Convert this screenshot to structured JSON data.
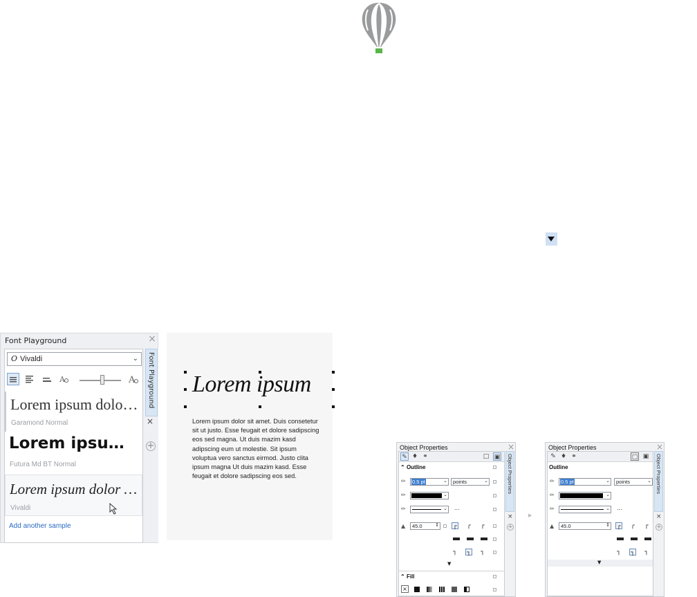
{
  "logo": {
    "icon": "balloon-logo-icon",
    "colors": {
      "body": "#9a9b9c",
      "basket": "#5bb54a"
    }
  },
  "font_playground": {
    "title": "Font Playground",
    "tab_label": "Font Playground",
    "close": "×",
    "selected_font": "Vivaldi",
    "font_icon": "O",
    "samples": [
      {
        "text": "Lorem ipsum dolor sit amet",
        "font": "Garamond Normal"
      },
      {
        "text": "Lorem ipsum dolor",
        "font": "Futura Md BT Normal"
      },
      {
        "text": "Lorem ipsum dolor sit amet",
        "font": "Vivaldi"
      }
    ],
    "add_sample": "Add another sample",
    "zoom_level": 0.55
  },
  "canvas": {
    "heading": "Lorem ipsum",
    "body": "Lorem ipsum dolor sit amet. Duis consetetur sit ut justo. Esse feugait et dolore sadipscing eos sed magna. Ut duis mazim kasd adipscing eum ut molestie. Sit ipsum voluptua vero sanctus eirmod. Justo clita ipsum magna Ut duis mazim kasd. Esse feugait et dolore sadipscing eos sed."
  },
  "object_properties_left": {
    "title": "Object Properties",
    "tab_label": "Object Properties",
    "outline_label": "Outline",
    "width_value": "0.5 pt",
    "units": "points",
    "miter": "45.0",
    "fill_label": "Fill",
    "more": "..."
  },
  "object_properties_right": {
    "title": "Object Properties",
    "tab_label": "Object Properties",
    "outline_label": "Outline",
    "width_value": "0.5 pt",
    "units": "points",
    "miter": "45.0",
    "more": "..."
  }
}
